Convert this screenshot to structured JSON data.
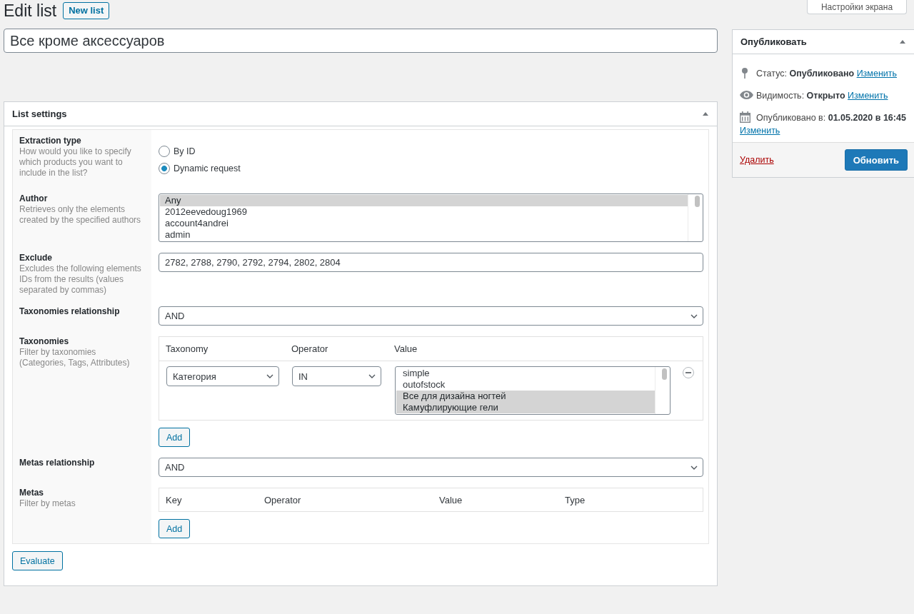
{
  "header": {
    "title": "Edit list",
    "new_button": "New list"
  },
  "screen_options": {
    "label": "Настройки экрана"
  },
  "list_title": {
    "value": "Все кроме аксессуаров"
  },
  "list_settings": {
    "title": "List settings",
    "fields": [
      {
        "kind": "radio",
        "label": "Extraction type",
        "description": "How would you like to specify which products you want to include in the list?",
        "options": [
          {
            "label": "By ID",
            "selected": false
          },
          {
            "label": "Dynamic request",
            "selected": true
          }
        ]
      },
      {
        "kind": "listbox",
        "label": "Author",
        "description": "Retrieves only the elements created by the specified authors",
        "options": [
          {
            "label": "Any",
            "selected": true
          },
          {
            "label": "2012eevedoug1969",
            "selected": false
          },
          {
            "label": "account4andrei",
            "selected": false
          },
          {
            "label": "admin",
            "selected": false
          }
        ]
      },
      {
        "kind": "text",
        "label": "Exclude",
        "description": "Excludes the following elements IDs from the results (values separated by commas)",
        "value": "2782, 2788, 2790, 2792, 2794, 2802, 2804"
      },
      {
        "kind": "select",
        "label": "Taxonomies relationship",
        "value": "AND"
      },
      {
        "kind": "taxonomies",
        "label": "Taxonomies",
        "description": "Filter by taxonomies (Categories, Tags, Attributes)",
        "columns": [
          "Taxonomy",
          "Operator",
          "Value"
        ],
        "rows": [
          {
            "taxonomy": "Категория",
            "operator": "IN",
            "values": [
              {
                "label": "simple",
                "selected": false
              },
              {
                "label": "outofstock",
                "selected": false
              },
              {
                "label": "Все для дизайна ногтей",
                "selected": true
              },
              {
                "label": "Камуфлирующие гели",
                "selected": true
              }
            ]
          }
        ],
        "add_button": "Add"
      },
      {
        "kind": "select",
        "label": "Metas relationship",
        "value": "AND"
      },
      {
        "kind": "metas",
        "label": "Metas",
        "description": "Filter by metas",
        "columns": [
          "Key",
          "Operator",
          "Value",
          "Type"
        ],
        "add_button": "Add"
      }
    ],
    "evaluate_button": "Evaluate"
  },
  "publish": {
    "title": "Опубликовать",
    "rows": [
      {
        "kind": "status",
        "label": "Статус:",
        "value": "Опубликовано",
        "link": "Изменить"
      },
      {
        "kind": "visibility",
        "label": "Видимость:",
        "value": "Открыто",
        "link": "Изменить"
      },
      {
        "kind": "date",
        "label": "Опубликовано в:",
        "value": "01.05.2020 в 16:45",
        "link": "Изменить"
      }
    ],
    "delete_link": "Удалить",
    "update_button": "Обновить"
  }
}
